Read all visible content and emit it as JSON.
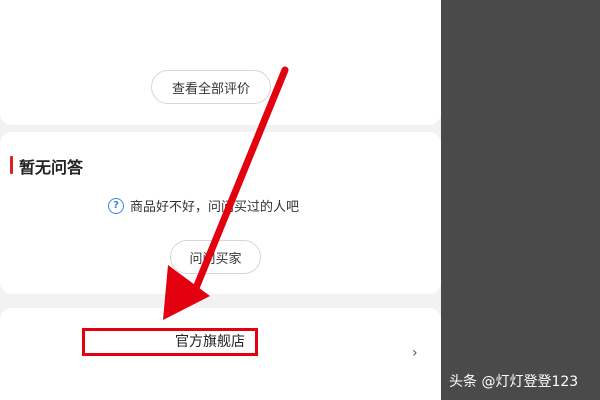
{
  "reviews": {
    "view_all_label": "查看全部评价"
  },
  "qa": {
    "title": "暂无问答",
    "hint": "商品好不好，问问买过的人吧",
    "ask_button_label": "问问买家"
  },
  "store": {
    "label": "官方旗舰店",
    "chevron": "›"
  },
  "watermark": "头条 @灯灯登登123",
  "colors": {
    "accent_red": "#e3000f",
    "info_blue": "#3a86e0",
    "side_bg": "#4a4a4a"
  },
  "icons": {
    "help": "question-circle-icon",
    "arrow": "red-annotation-arrow"
  }
}
